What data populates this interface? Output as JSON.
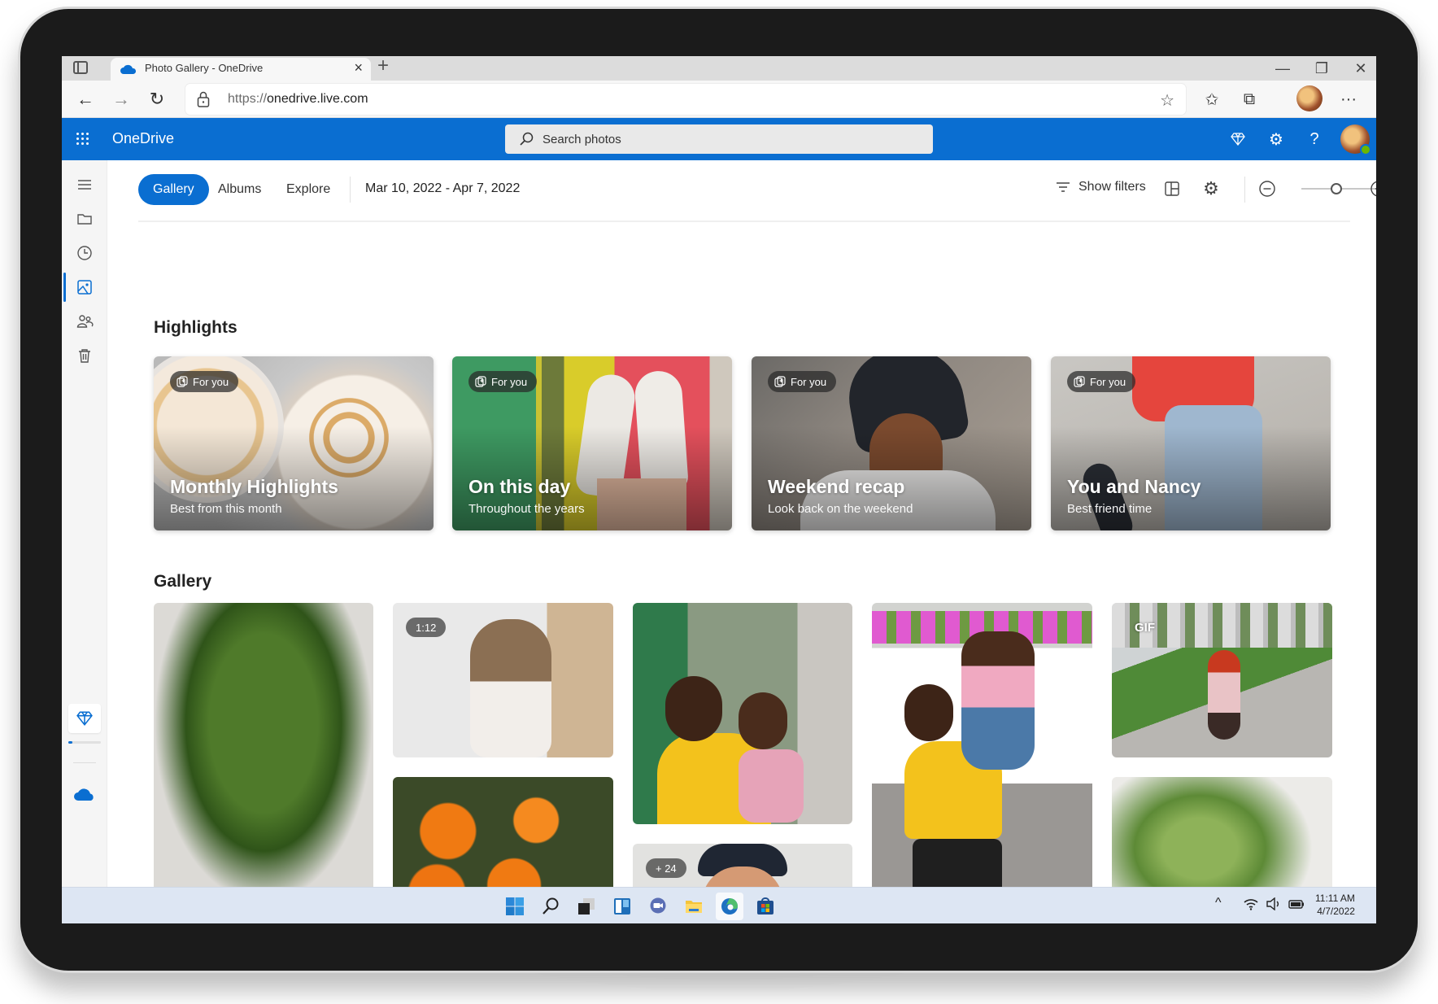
{
  "browser": {
    "tab_title": "Photo Gallery - OneDrive",
    "url_scheme": "https://",
    "url_host": "onedrive.live.com",
    "tab_close": "×",
    "new_tab": "+",
    "window_controls": {
      "minimize": "—",
      "restore": "❐",
      "close": "✕"
    },
    "nav": {
      "back": "←",
      "forward": "→",
      "refresh": "↻",
      "more": "···"
    }
  },
  "header": {
    "brand": "OneDrive",
    "search_placeholder": "Search photos",
    "help": "?",
    "accent_color": "#0a6ed1"
  },
  "rail": {
    "items": [
      {
        "name": "menu",
        "icon": "hamburger-icon"
      },
      {
        "name": "my-files",
        "icon": "folder-icon"
      },
      {
        "name": "recent",
        "icon": "clock-icon"
      },
      {
        "name": "photos",
        "icon": "image-icon",
        "active": true
      },
      {
        "name": "shared",
        "icon": "people-icon"
      },
      {
        "name": "recycle-bin",
        "icon": "trash-icon"
      }
    ],
    "storage_used_fraction": 0.12
  },
  "toolbar": {
    "tabs": [
      {
        "label": "Gallery",
        "active": true
      },
      {
        "label": "Albums",
        "active": false
      },
      {
        "label": "Explore",
        "active": false
      }
    ],
    "date_range": "Mar 10, 2022 - Apr 7, 2022",
    "show_filters": "Show filters",
    "zoom_level_fraction": 0.48
  },
  "highlights": {
    "title": "Highlights",
    "cards": [
      {
        "badge": "For you",
        "title": "Monthly Highlights",
        "subtitle": "Best from this month"
      },
      {
        "badge": "For you",
        "title": "On this day",
        "subtitle": "Throughout the years"
      },
      {
        "badge": "For you",
        "title": "Weekend recap",
        "subtitle": "Look back on the weekend"
      },
      {
        "badge": "For you",
        "title": "You and Nancy",
        "subtitle": "Best friend time"
      }
    ]
  },
  "gallery": {
    "title": "Gallery",
    "tiles": [
      {
        "subject": "potted dieffenbachia plant",
        "badge": ""
      },
      {
        "subject": "cat peeking around wall",
        "badge": "1:12"
      },
      {
        "subject": "orange marigold flowers",
        "badge": ""
      },
      {
        "subject": "man hugging child by green fence",
        "badge": ""
      },
      {
        "subject": "woman laughing in backwards cap",
        "badge": "+ 24"
      },
      {
        "subject": "man lifting child into the air",
        "badge": ""
      },
      {
        "subject": "girl roller skating in park",
        "badge": "GIF"
      },
      {
        "subject": "green houseplant leaves",
        "badge": ""
      }
    ]
  },
  "taskbar": {
    "apps": [
      "start",
      "search",
      "task-view",
      "widgets",
      "chat",
      "file-explorer",
      "edge",
      "store"
    ],
    "active_app": "edge",
    "time": "11:11 AM",
    "date": "4/7/2022",
    "tray_chevron": "^"
  }
}
